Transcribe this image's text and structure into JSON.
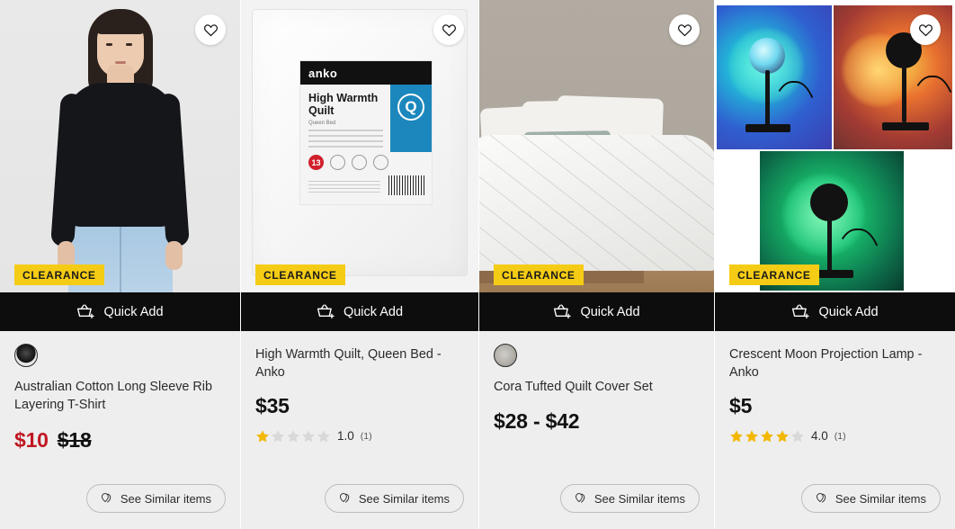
{
  "page": {
    "layout": "product-grid",
    "columns": 4,
    "badge_color": "#f5cc15",
    "quickadd_bar_color": "#0d0d0d",
    "sale_price_color": "#c01722"
  },
  "labels": {
    "quick_add": "Quick Add",
    "see_similar": "See Similar items",
    "clearance": "CLEARANCE"
  },
  "icons": {
    "favourite": "heart-icon",
    "quick_add": "basket-plus-icon",
    "see_similar": "similar-items-icon",
    "star": "star-icon"
  },
  "products": [
    {
      "id": "p1",
      "title": "Australian Cotton Long Sleeve Rib Layering T-Shirt",
      "badge": "CLEARANCE",
      "price": "$10",
      "was_price": "$18",
      "on_sale": true,
      "has_swatch": true,
      "swatch_name": "black-tee-swatch",
      "rating": null,
      "rating_count": null,
      "quick_add": "Quick Add",
      "see_similar": "See Similar items",
      "image_alt": "Model wearing black long sleeve rib t-shirt with blue jeans"
    },
    {
      "id": "p2",
      "title": "High Warmth Quilt, Queen Bed - Anko",
      "badge": "CLEARANCE",
      "price": "$35",
      "was_price": null,
      "on_sale": false,
      "has_swatch": false,
      "rating": "1.0",
      "rating_stars": 1,
      "rating_count": "(1)",
      "quick_add": "Quick Add",
      "see_similar": "See Similar items",
      "image_alt": "Anko High Warmth Quilt packaging",
      "pack": {
        "brand": "anko",
        "title_line1": "High Warmth",
        "title_line2": "Quilt",
        "subtitle": "Queen Bed",
        "size_letter": "Q",
        "warmth_rating": "13"
      }
    },
    {
      "id": "p3",
      "title": "Cora Tufted Quilt Cover Set",
      "badge": "CLEARANCE",
      "price": "$28 - $42",
      "was_price": null,
      "on_sale": false,
      "has_swatch": true,
      "swatch_name": "cora-quilt-swatch",
      "rating": null,
      "rating_count": null,
      "quick_add": "Quick Add",
      "see_similar": "See Similar items",
      "image_alt": "White tufted quilt cover set on a bed with green cushion"
    },
    {
      "id": "p4",
      "title": "Crescent Moon Projection Lamp - Anko",
      "badge": "CLEARANCE",
      "price": "$5",
      "was_price": null,
      "on_sale": false,
      "has_swatch": false,
      "rating": "4.0",
      "rating_stars": 4,
      "rating_count": "(1)",
      "quick_add": "Quick Add",
      "see_similar": "See Similar items",
      "image_alt": "Crescent moon projection lamp shown in blue, orange and green light"
    }
  ]
}
